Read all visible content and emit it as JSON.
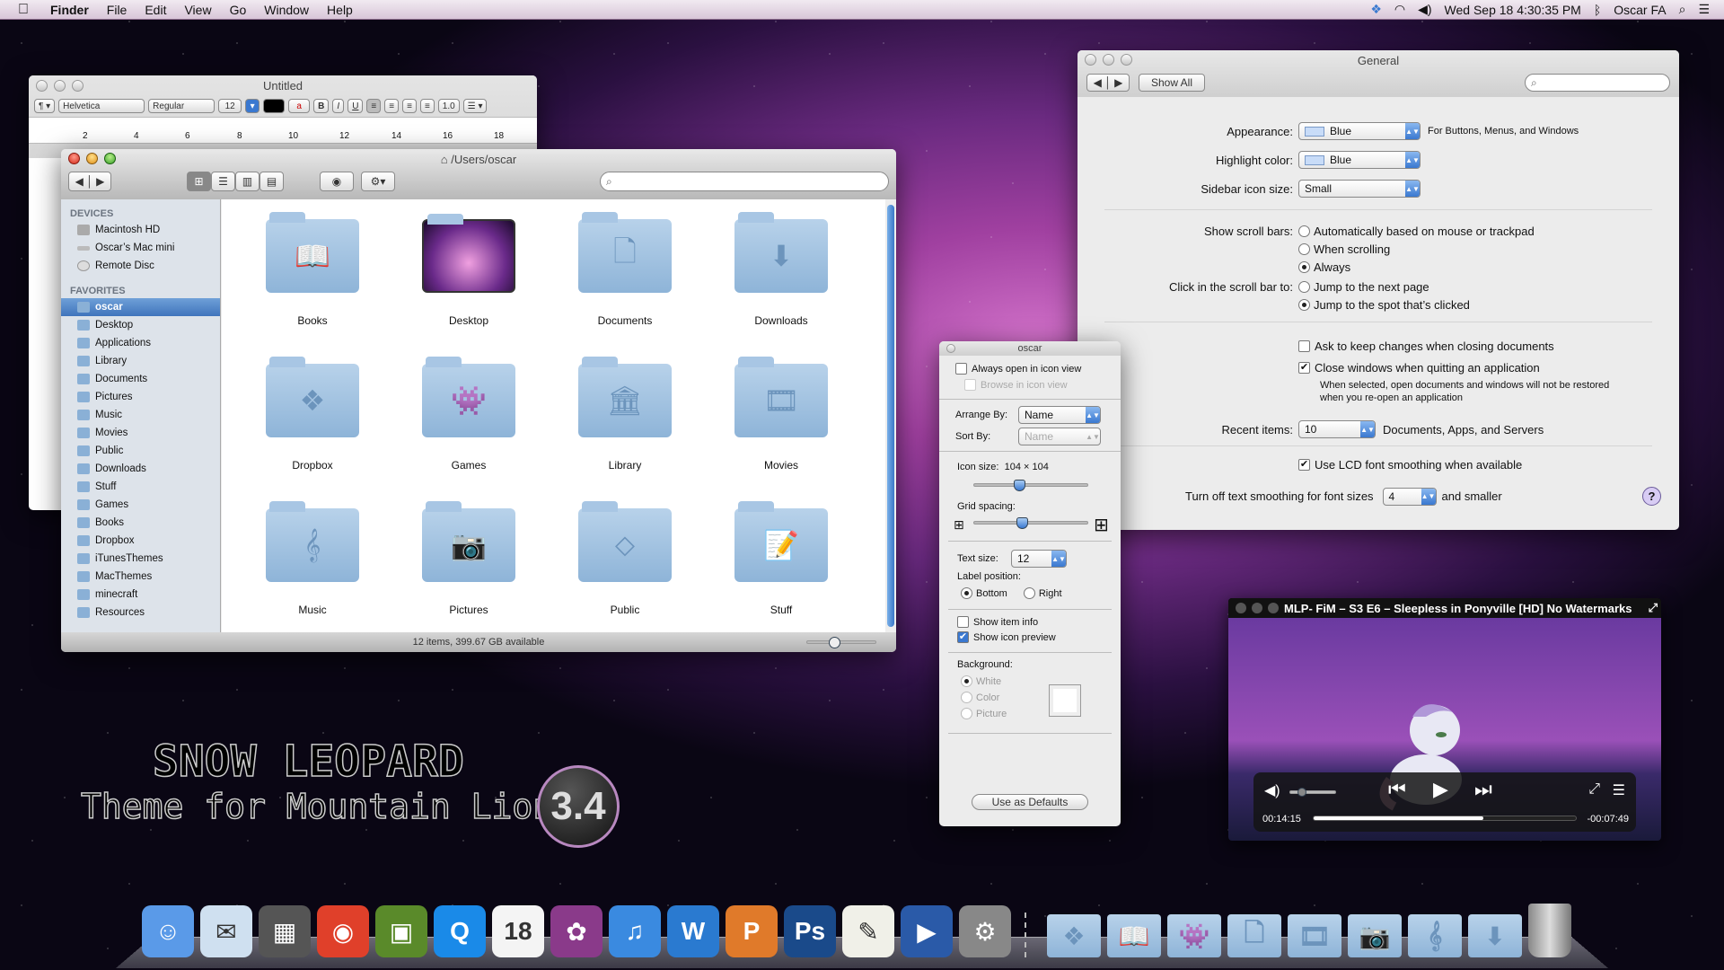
{
  "menubar": {
    "apple": "",
    "app": "Finder",
    "menus": [
      "File",
      "Edit",
      "View",
      "Go",
      "Window",
      "Help"
    ],
    "status": {
      "dropbox": "dropbox-icon",
      "wifi": "wifi-icon",
      "volume": "volume-icon",
      "clock": "Wed Sep 18  4:30:35 PM",
      "bluetooth": "bluetooth-icon",
      "user": "Oscar FA",
      "spotlight": "spotlight-icon",
      "notifications": "notification-center-icon"
    }
  },
  "textedit": {
    "title": "Untitled",
    "paragraph": "¶ ▾",
    "font": "Helvetica",
    "style": "Regular",
    "size": "12",
    "spacing": "1.0",
    "list": "☰ ▾",
    "ruler_ticks": [
      "2",
      "4",
      "6",
      "8",
      "10",
      "12",
      "14",
      "16",
      "18"
    ]
  },
  "finder": {
    "title": "/Users/oscar",
    "search_placeholder": "",
    "sidebar": {
      "devices_header": "DEVICES",
      "devices": [
        "Macintosh HD",
        "Oscar’s Mac mini",
        "Remote Disc"
      ],
      "favorites_header": "FAVORITES",
      "favorites": [
        "oscar",
        "Desktop",
        "Applications",
        "Library",
        "Documents",
        "Pictures",
        "Music",
        "Movies",
        "Public",
        "Downloads",
        "Stuff",
        "Games",
        "Books",
        "Dropbox",
        "iTunesThemes",
        "MacThemes",
        "minecraft",
        "Resources"
      ],
      "selected": "oscar"
    },
    "items": [
      {
        "name": "Books",
        "glyph": "📖"
      },
      {
        "name": "Desktop",
        "glyph": ""
      },
      {
        "name": "Documents",
        "glyph": "🗋"
      },
      {
        "name": "Downloads",
        "glyph": "⬇"
      },
      {
        "name": "Dropbox",
        "glyph": "❖"
      },
      {
        "name": "Games",
        "glyph": "👾"
      },
      {
        "name": "Library",
        "glyph": "🏛"
      },
      {
        "name": "Movies",
        "glyph": "🎞"
      },
      {
        "name": "Music",
        "glyph": "𝄞"
      },
      {
        "name": "Pictures",
        "glyph": "📷"
      },
      {
        "name": "Public",
        "glyph": "⬦"
      },
      {
        "name": "Stuff",
        "glyph": "📝"
      }
    ],
    "status": "12 items, 399.67 GB available",
    "icon_zoom_fraction": 0.4
  },
  "prefs": {
    "title": "General",
    "show_all": "Show All",
    "search_placeholder": "",
    "appearance_label": "Appearance:",
    "appearance_value": "Blue",
    "appearance_note": "For Buttons, Menus, and Windows",
    "highlight_label": "Highlight color:",
    "highlight_value": "Blue",
    "sidebar_size_label": "Sidebar icon size:",
    "sidebar_size_value": "Small",
    "scrollbars_label": "Show scroll bars:",
    "scrollbar_options": [
      "Automatically based on mouse or trackpad",
      "When scrolling",
      "Always"
    ],
    "scrollbar_selected": 2,
    "click_label": "Click in the scroll bar to:",
    "click_options": [
      "Jump to the next page",
      "Jump to the spot that’s clicked"
    ],
    "click_selected": 1,
    "ask_keep": "Ask to keep changes when closing documents",
    "ask_keep_checked": false,
    "close_windows": "Close windows when quitting an application",
    "close_windows_checked": true,
    "close_note": "When selected, open documents and windows will not be restored when you re-open an application",
    "recent_label": "Recent items:",
    "recent_value": "10",
    "recent_note": "Documents, Apps, and Servers",
    "lcd": "Use LCD font smoothing when available",
    "lcd_checked": true,
    "smoothing_label": "Turn off text smoothing for font sizes",
    "smoothing_value": "4",
    "smoothing_note": "and smaller",
    "help": "?"
  },
  "viewopts": {
    "title": "oscar",
    "always_open": "Always open in icon view",
    "browse": "Browse in icon view",
    "arrange_label": "Arrange By:",
    "arrange_value": "Name",
    "sort_label": "Sort By:",
    "sort_value": "Name",
    "icon_size_label": "Icon size:",
    "icon_size_value": "104 × 104",
    "icon_size_fraction": 0.4,
    "grid_label": "Grid spacing:",
    "grid_fraction": 0.42,
    "text_size_label": "Text size:",
    "text_size_value": "12",
    "label_pos_label": "Label position:",
    "label_bottom": "Bottom",
    "label_right": "Right",
    "show_item_info": "Show item info",
    "show_icon_preview": "Show icon preview",
    "background_label": "Background:",
    "bg_options": [
      "White",
      "Color",
      "Picture"
    ],
    "use_defaults": "Use as Defaults"
  },
  "video": {
    "title": "MLP- FiM – S3 E6 – Sleepless in Ponyville [HD] No Watermarks",
    "elapsed": "00:14:15",
    "remaining": "-00:07:49",
    "progress_fraction": 0.646,
    "volume_fraction": 0.25
  },
  "brand": {
    "line1": "SNOW LEOPARD",
    "line2": "Theme for Mountain Lion",
    "version": "3.4"
  },
  "dock": {
    "apps": [
      {
        "name": "Finder",
        "glyph": "☺",
        "color": "#5a9ae8"
      },
      {
        "name": "Mail",
        "glyph": "✉",
        "color": "#cfe0f0"
      },
      {
        "name": "Dashboard",
        "glyph": "▦",
        "color": "#555"
      },
      {
        "name": "Chrome",
        "glyph": "◉",
        "color": "#e0402a"
      },
      {
        "name": "Minecraft",
        "glyph": "▣",
        "color": "#5a8a2a"
      },
      {
        "name": "QuickTime",
        "glyph": "Q",
        "color": "#1a8ae8"
      },
      {
        "name": "Calendar",
        "glyph": "18",
        "color": "#f4f4f4"
      },
      {
        "name": "Anime App",
        "glyph": "✿",
        "color": "#8a3a8a"
      },
      {
        "name": "iTunes",
        "glyph": "♫",
        "color": "#3a8ae0"
      },
      {
        "name": "Word",
        "glyph": "W",
        "color": "#2a7ad0"
      },
      {
        "name": "PowerPoint",
        "glyph": "P",
        "color": "#e07a2a"
      },
      {
        "name": "Photoshop",
        "glyph": "Ps",
        "color": "#1a4a8a"
      },
      {
        "name": "TextEdit",
        "glyph": "✎",
        "color": "#f0f0e8"
      },
      {
        "name": "Media Player",
        "glyph": "▶",
        "color": "#2a5aa8"
      },
      {
        "name": "System Preferences",
        "glyph": "⚙",
        "color": "#888"
      }
    ],
    "stacks": [
      {
        "name": "Dropbox",
        "glyph": "❖"
      },
      {
        "name": "Books",
        "glyph": "📖"
      },
      {
        "name": "Games",
        "glyph": "👾"
      },
      {
        "name": "Documents",
        "glyph": "🗋"
      },
      {
        "name": "Movies",
        "glyph": "🎞"
      },
      {
        "name": "Pictures",
        "glyph": "📷"
      },
      {
        "name": "Music",
        "glyph": "𝄞"
      },
      {
        "name": "Downloads",
        "glyph": "⬇"
      }
    ],
    "trash": "Trash"
  }
}
